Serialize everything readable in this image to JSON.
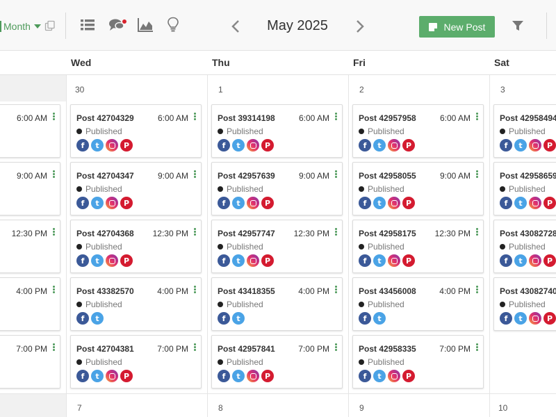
{
  "toolbar": {
    "view_label": "Month",
    "month_label": "May 2025",
    "new_post_label": "New Post",
    "accent_color": "#4e9a5b",
    "button_color": "#5cad6c",
    "icons": [
      "copy-icon",
      "list-icon",
      "comments-icon",
      "analytics-icon",
      "idea-icon",
      "chevron-left-icon",
      "chevron-right-icon",
      "filter-icon"
    ]
  },
  "days_header": [
    "Wed",
    "Thu",
    "Fri",
    "Sat"
  ],
  "week1_dates": [
    "30",
    "1",
    "2",
    "3"
  ],
  "week2_dates": [
    "7",
    "8",
    "9",
    "10"
  ],
  "status_dot_color": "#222222",
  "columns": [
    {
      "key": "tue",
      "posts": [
        {
          "title": "",
          "time": "6:00 AM",
          "status": "",
          "networks": []
        },
        {
          "title": "",
          "time": "9:00 AM",
          "status": "",
          "networks": []
        },
        {
          "title": "",
          "time": "12:30 PM",
          "status": "",
          "networks": []
        },
        {
          "title": "",
          "time": "4:00 PM",
          "status": "",
          "networks": []
        },
        {
          "title": "",
          "time": "7:00 PM",
          "status": "",
          "networks": []
        }
      ]
    },
    {
      "key": "wed",
      "posts": [
        {
          "title": "Post 42704329",
          "time": "6:00 AM",
          "status": "Published",
          "networks": [
            "facebook",
            "twitter",
            "instagram",
            "pinterest"
          ]
        },
        {
          "title": "Post 42704347",
          "time": "9:00 AM",
          "status": "Published",
          "networks": [
            "facebook",
            "twitter",
            "instagram",
            "pinterest"
          ]
        },
        {
          "title": "Post 42704368",
          "time": "12:30 PM",
          "status": "Published",
          "networks": [
            "facebook",
            "twitter",
            "instagram",
            "pinterest"
          ]
        },
        {
          "title": "Post 43382570",
          "time": "4:00 PM",
          "status": "Published",
          "networks": [
            "facebook",
            "twitter"
          ]
        },
        {
          "title": "Post 42704381",
          "time": "7:00 PM",
          "status": "Published",
          "networks": [
            "facebook",
            "twitter",
            "instagram",
            "pinterest"
          ]
        }
      ]
    },
    {
      "key": "thu",
      "posts": [
        {
          "title": "Post 39314198",
          "time": "6:00 AM",
          "status": "Published",
          "networks": [
            "facebook",
            "twitter",
            "instagram",
            "pinterest"
          ]
        },
        {
          "title": "Post 42957639",
          "time": "9:00 AM",
          "status": "Published",
          "networks": [
            "facebook",
            "twitter",
            "instagram",
            "pinterest"
          ]
        },
        {
          "title": "Post 42957747",
          "time": "12:30 PM",
          "status": "Published",
          "networks": [
            "facebook",
            "twitter",
            "instagram",
            "pinterest"
          ]
        },
        {
          "title": "Post 43418355",
          "time": "4:00 PM",
          "status": "Published",
          "networks": [
            "facebook",
            "twitter"
          ]
        },
        {
          "title": "Post 42957841",
          "time": "7:00 PM",
          "status": "Published",
          "networks": [
            "facebook",
            "twitter",
            "instagram",
            "pinterest"
          ]
        }
      ]
    },
    {
      "key": "fri",
      "posts": [
        {
          "title": "Post 42957958",
          "time": "6:00 AM",
          "status": "Published",
          "networks": [
            "facebook",
            "twitter",
            "instagram",
            "pinterest"
          ]
        },
        {
          "title": "Post 42958055",
          "time": "9:00 AM",
          "status": "Published",
          "networks": [
            "facebook",
            "twitter",
            "instagram",
            "pinterest"
          ]
        },
        {
          "title": "Post 42958175",
          "time": "12:30 PM",
          "status": "Published",
          "networks": [
            "facebook",
            "twitter",
            "instagram",
            "pinterest"
          ]
        },
        {
          "title": "Post 43456008",
          "time": "4:00 PM",
          "status": "Published",
          "networks": [
            "facebook",
            "twitter"
          ]
        },
        {
          "title": "Post 42958335",
          "time": "7:00 PM",
          "status": "Published",
          "networks": [
            "facebook",
            "twitter",
            "instagram",
            "pinterest"
          ]
        }
      ]
    },
    {
      "key": "sat",
      "posts": [
        {
          "title": "Post 42958494",
          "time": "",
          "status": "Published",
          "networks": [
            "facebook",
            "twitter",
            "instagram",
            "pinterest"
          ]
        },
        {
          "title": "Post 42958659",
          "time": "",
          "status": "Published",
          "networks": [
            "facebook",
            "twitter",
            "instagram",
            "pinterest"
          ]
        },
        {
          "title": "Post 43082728",
          "time": "",
          "status": "Published",
          "networks": [
            "facebook",
            "twitter",
            "instagram",
            "pinterest"
          ]
        },
        {
          "title": "Post 43082740",
          "time": "",
          "status": "Published",
          "networks": [
            "facebook",
            "twitter",
            "instagram",
            "pinterest"
          ]
        }
      ]
    }
  ]
}
